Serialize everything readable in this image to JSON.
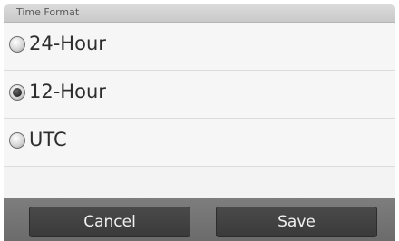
{
  "dialog": {
    "title": "Time Format"
  },
  "options": [
    {
      "label": "24-Hour",
      "selected": false
    },
    {
      "label": "12-Hour",
      "selected": true
    },
    {
      "label": "UTC",
      "selected": false
    }
  ],
  "actions": {
    "cancel_label": "Cancel",
    "save_label": "Save"
  }
}
